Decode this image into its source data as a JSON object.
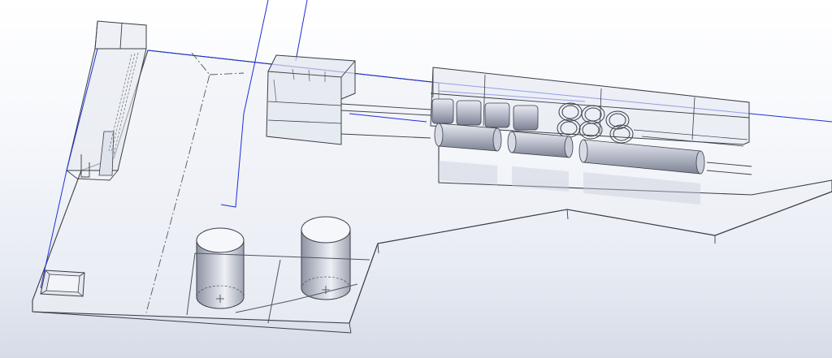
{
  "viewport": {
    "view": "isometric",
    "display_style": "shaded-with-edges",
    "background": "gradient"
  },
  "colors": {
    "background_top": "#ffffff",
    "background_bottom": "#d6dce7",
    "edge": "#3a3e47",
    "sketch_line": "#1f2fd6",
    "body_face": "#dfe3ec",
    "shadow": "#c9ced9"
  },
  "model": {
    "entities": [
      "floor-slab",
      "left-building",
      "walkway-column",
      "pump-house",
      "processing-line-enclosure",
      "horizontal-tank-row-1",
      "horizontal-tank-row-2",
      "coil-ring-group",
      "storage-tank-1",
      "storage-tank-2",
      "small-pit-box",
      "centerlines"
    ]
  }
}
